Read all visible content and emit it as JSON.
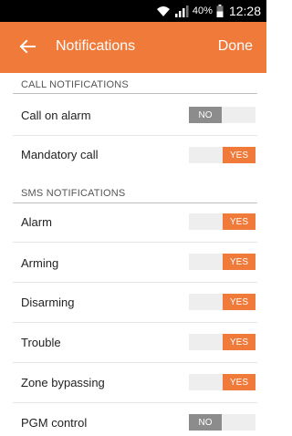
{
  "status_bar": {
    "battery_percent": "40%",
    "time": "12:28",
    "wifi_icon": "wifi-icon",
    "signal_icon": "cell-signal-icon",
    "battery_icon": "battery-icon"
  },
  "app_bar": {
    "title": "Notifications",
    "done_label": "Done",
    "back_icon": "arrow-back-icon",
    "color": "#f07a3a"
  },
  "sections": {
    "call": {
      "header": "CALL NOTIFICATIONS",
      "rows": [
        {
          "label": "Call on alarm",
          "toggle": "NO",
          "on": false
        },
        {
          "label": "Mandatory call",
          "toggle": "YES",
          "on": true
        }
      ]
    },
    "sms": {
      "header": "SMS NOTIFICATIONS",
      "rows": [
        {
          "label": "Alarm",
          "toggle": "YES",
          "on": true
        },
        {
          "label": "Arming",
          "toggle": "YES",
          "on": true
        },
        {
          "label": "Disarming",
          "toggle": "YES",
          "on": true
        },
        {
          "label": "Trouble",
          "toggle": "YES",
          "on": true
        },
        {
          "label": "Zone bypassing",
          "toggle": "YES",
          "on": true
        },
        {
          "label": "PGM control",
          "toggle": "NO",
          "on": false
        }
      ]
    }
  },
  "colors": {
    "accent": "#f07a3a",
    "toggle_off": "#8c8c8c",
    "toggle_track": "#eeeeee"
  }
}
